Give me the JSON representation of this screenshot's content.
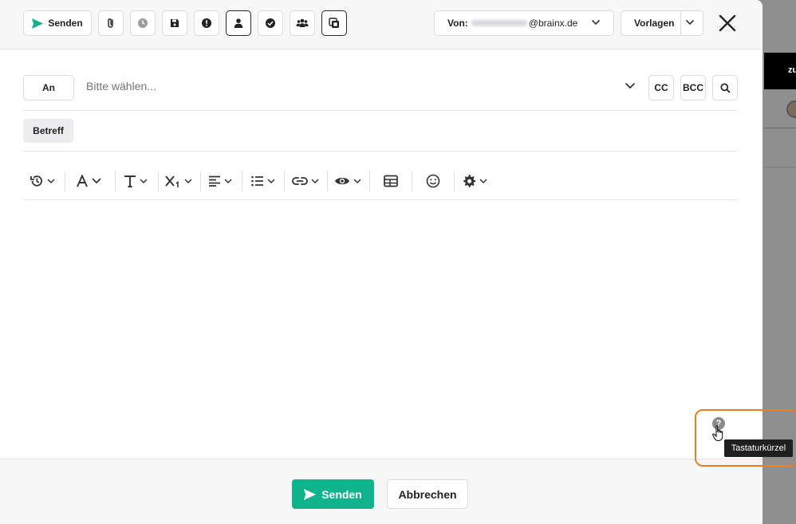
{
  "toolbar": {
    "send_label": "Senden",
    "icons": [
      "attach-icon",
      "clock-icon",
      "save-icon",
      "priority-icon",
      "contact-icon",
      "check-icon",
      "group-icon",
      "copy-icon"
    ]
  },
  "from": {
    "label": "Von:",
    "domain": "@brainx.de"
  },
  "templates": {
    "label": "Vorlagen"
  },
  "to": {
    "button_label": "An",
    "placeholder": "Bitte wählen..."
  },
  "cc_label": "CC",
  "bcc_label": "BCC",
  "subject_label": "Betreff",
  "editor": {
    "tools": [
      "history",
      "font-color",
      "text-size",
      "subscript",
      "align",
      "list",
      "link",
      "preview",
      "table",
      "emoji",
      "settings"
    ]
  },
  "help": {
    "question_mark": "?",
    "tooltip": "Tastaturkürzel"
  },
  "footer": {
    "send_label": "Senden",
    "cancel_label": "Abbrechen"
  },
  "background": {
    "partial_text": "zu"
  },
  "colors": {
    "accent_green": "#0fb48c",
    "highlight_orange": "#ef7d22",
    "overlay": "#8f8f8f"
  }
}
